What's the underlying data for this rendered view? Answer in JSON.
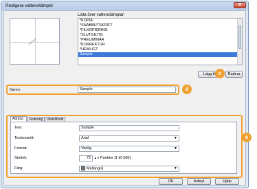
{
  "window": {
    "title": "Redigera vattenstämpel",
    "close_glyph": "✕"
  },
  "preview": {
    "watermark_text": "Sample"
  },
  "list": {
    "label": "Lista över vattenstämplar:",
    "items": [
      "*KOPIA",
      "*SNABBUTSKRIFT",
      "*FILKOPIERING",
      "*SLUTGILTIG",
      "*PRELIMINÄR",
      "*KORREKTUR",
      "*HEMLIGT",
      "Sample"
    ],
    "selected_index": 7
  },
  "buttons": {
    "add": "Lägg till",
    "delete": "Radera",
    "ok": "OK",
    "cancel": "Avbryt",
    "help": "Hjälp"
  },
  "callouts": {
    "c": "c",
    "d": "d",
    "e": "e"
  },
  "name": {
    "label": "Namn:",
    "value": "Sample"
  },
  "tabs": [
    "Attribut",
    "Justering",
    "Utskriftsstil"
  ],
  "attributes": {
    "text_label": "Text:",
    "text_value": "Sample",
    "font_label": "Teckensnitt:",
    "font_value": "Arial",
    "style_label": "Format:",
    "style_value": "Vanlig",
    "size_label": "Storlek:",
    "size_value": "72",
    "size_unit": "Punkter [1 till 500]",
    "color_label": "Färg:",
    "color_value": "Mellangrå"
  },
  "colors": {
    "accent": "#f0a030",
    "selection": "#3d7ad9",
    "swatch": "#777777"
  }
}
